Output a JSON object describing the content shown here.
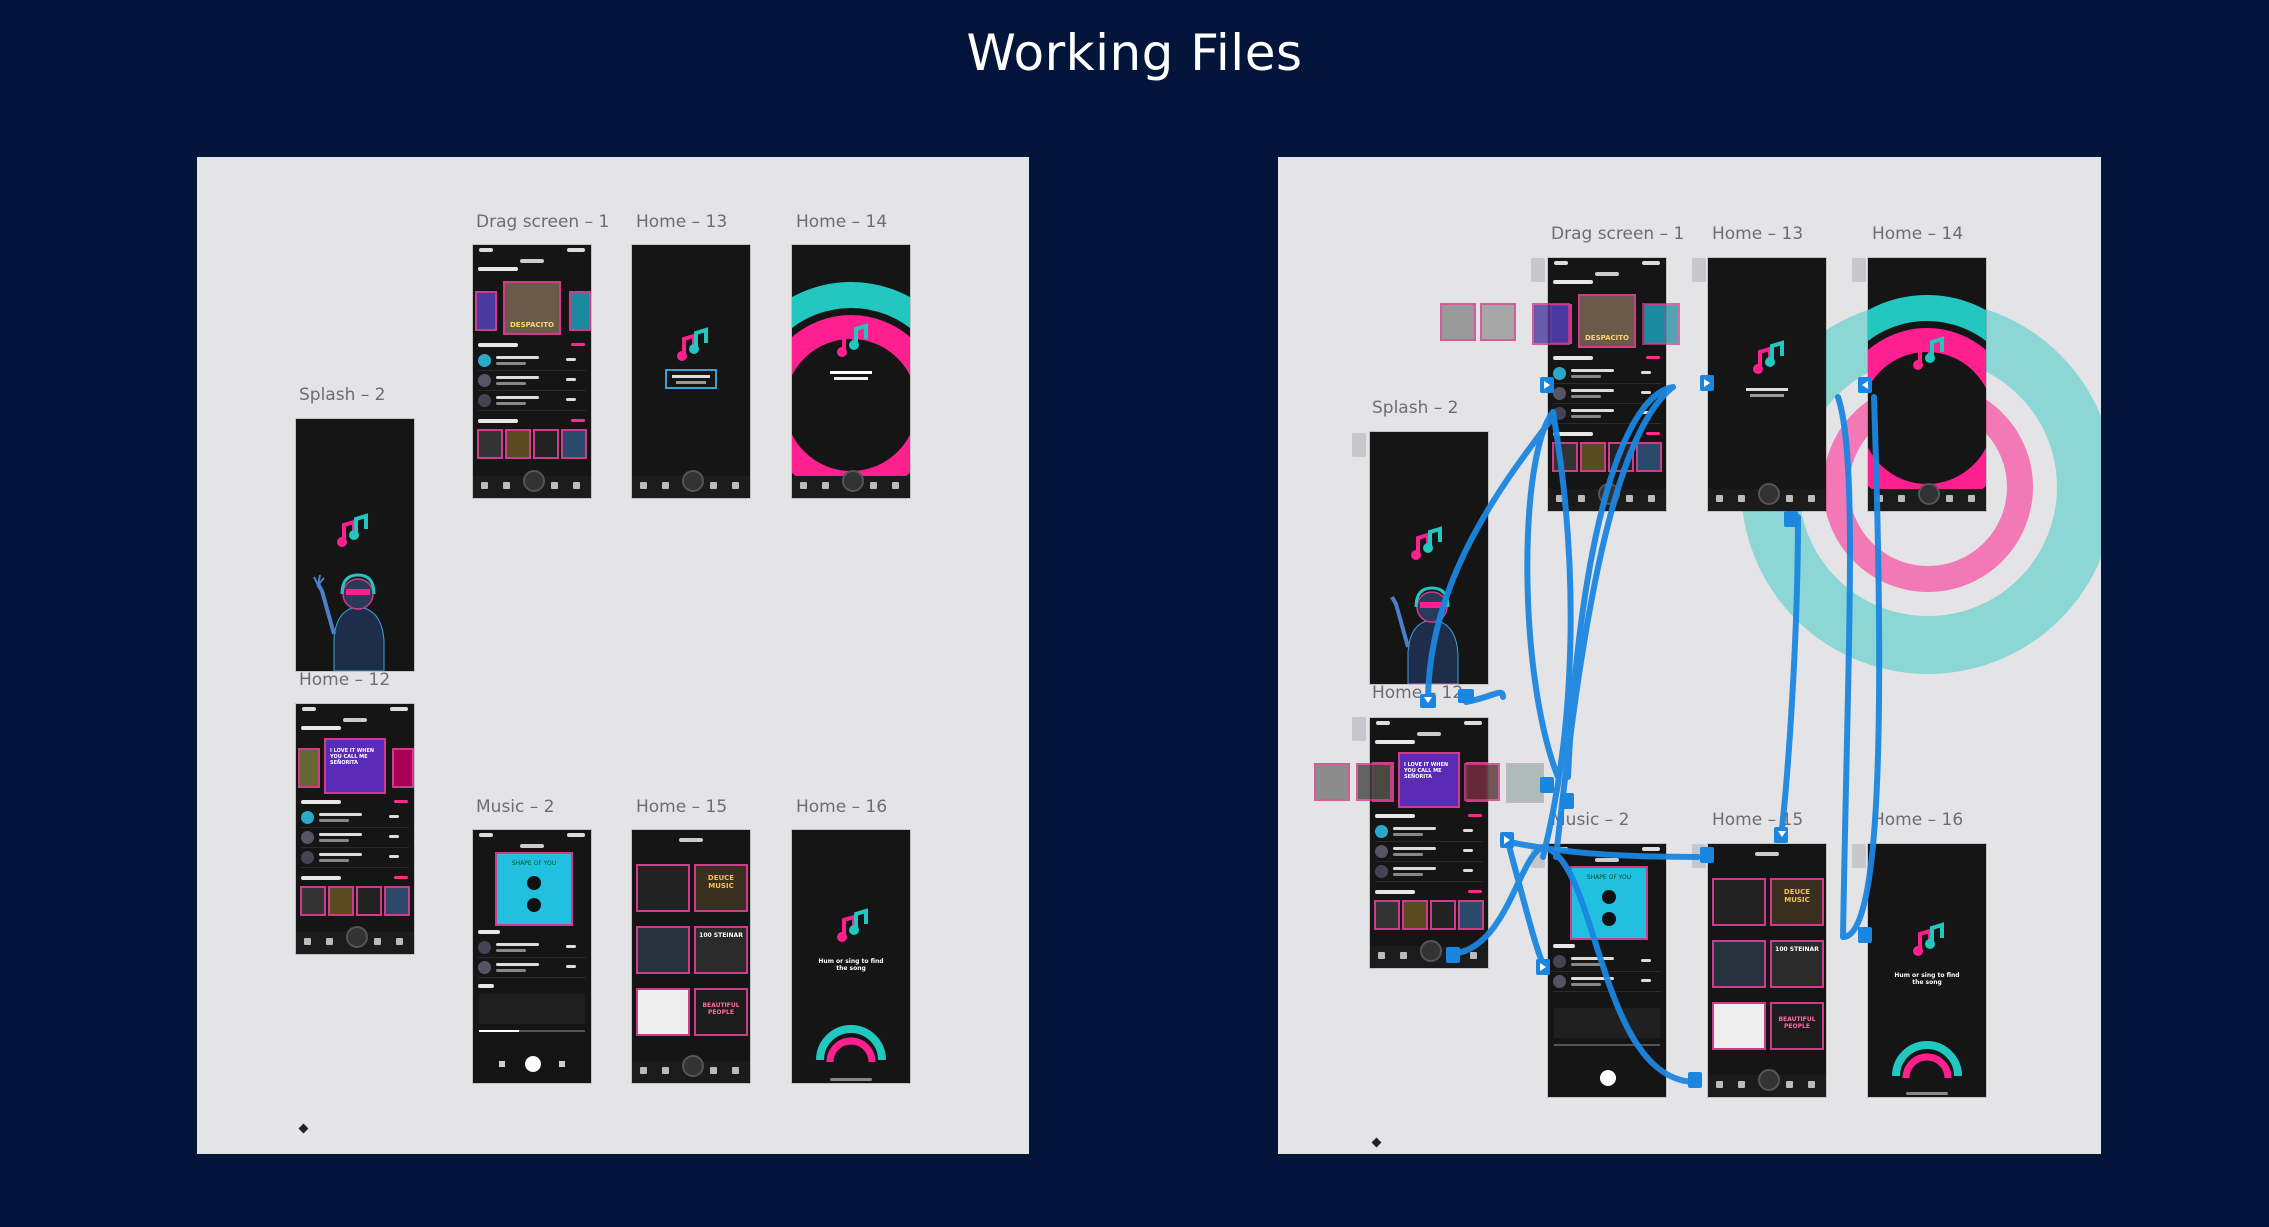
{
  "title": "Working Files",
  "left_panel": {
    "artboards": {
      "splash_2": "Splash – 2",
      "home_12": "Home – 12",
      "drag_screen_1": "Drag screen – 1",
      "home_13": "Home – 13",
      "home_14": "Home – 14",
      "music_2": "Music – 2",
      "home_15": "Home – 15",
      "home_16": "Home – 16"
    }
  },
  "right_panel": {
    "artboards": {
      "splash_2": "Splash – 2",
      "home_12": "Home – 12",
      "drag_screen_1": "Drag screen – 1",
      "home_13": "Home – 13",
      "home_14": "Home – 14",
      "music_2": "Music – 2",
      "home_15": "Home – 15",
      "home_16": "Home – 16"
    }
  },
  "screen_text": {
    "hero_despacito": "DESPACITO",
    "hero_senorita": "I LOVE IT WHEN YOU CALL ME SEÑORITA",
    "album_shape": "SHAPE OF YOU",
    "album_deuce": "DEUCE MUSIC",
    "album_100": "100 STEINAR",
    "album_beautiful": "BEAUTIFUL PEOPLE",
    "hum_prompt": "Hum or sing to find the song"
  },
  "colors": {
    "background": "#03153a",
    "panel": "#e4e4e6",
    "screen": "#151515",
    "accent_teal": "#22c7c0",
    "accent_pink": "#ff1f8e",
    "wire_blue": "#1b86e0"
  }
}
